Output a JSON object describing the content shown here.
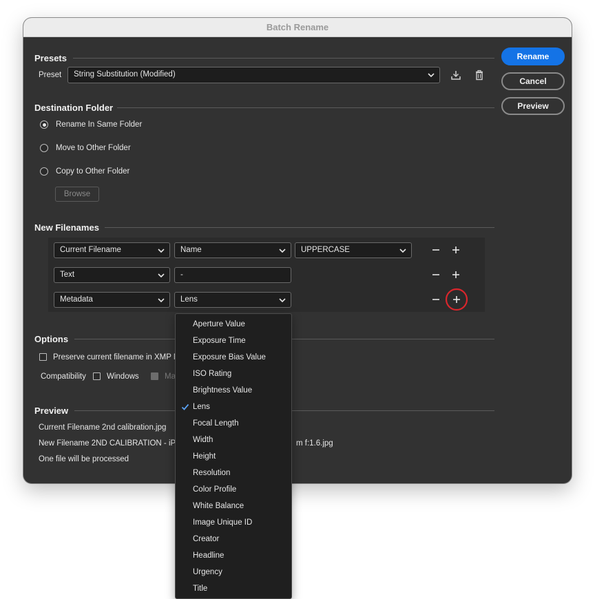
{
  "window": {
    "title": "Batch Rename"
  },
  "actions": {
    "rename": "Rename",
    "cancel": "Cancel",
    "preview": "Preview"
  },
  "presets": {
    "section_title": "Presets",
    "preset_label": "Preset",
    "preset_value": "String Substitution (Modified)",
    "save_icon": "save-preset-icon",
    "delete_icon": "trash-icon"
  },
  "destination": {
    "section_title": "Destination Folder",
    "options": [
      {
        "label": "Rename In Same Folder",
        "selected": true
      },
      {
        "label": "Move to Other Folder",
        "selected": false
      },
      {
        "label": "Copy to Other Folder",
        "selected": false
      }
    ],
    "browse_label": "Browse"
  },
  "new_filenames": {
    "section_title": "New Filenames",
    "rows": [
      {
        "type": "Current Filename",
        "field": "Name",
        "case": "UPPERCASE"
      },
      {
        "type": "Text",
        "text_value": "-"
      },
      {
        "type": "Metadata",
        "field": "Lens"
      }
    ]
  },
  "metadata_menu": {
    "items": [
      "Aperture Value",
      "Exposure Time",
      "Exposure Bias Value",
      "ISO Rating",
      "Brightness Value",
      "Lens",
      "Focal Length",
      "Width",
      "Height",
      "Resolution",
      "Color Profile",
      "White Balance",
      "Image Unique ID",
      "Creator",
      "Headline",
      "Urgency",
      "Title"
    ],
    "selected": "Lens"
  },
  "options": {
    "section_title": "Options",
    "preserve_label": "Preserve current filename in XMP M",
    "compatibility_label": "Compatibility",
    "windows_label": "Windows",
    "mac_label": "Ma"
  },
  "preview": {
    "section_title": "Preview",
    "current_filename": "Current Filename 2nd calibration.jpg",
    "new_filename_left": "New Filename 2ND CALIBRATION - iPho",
    "new_filename_right": "m f:1.6.jpg",
    "summary": "One file will be processed"
  },
  "colors": {
    "accent": "#1473e6",
    "highlight_ring": "#d9262c",
    "dialog_bg": "#323232"
  }
}
